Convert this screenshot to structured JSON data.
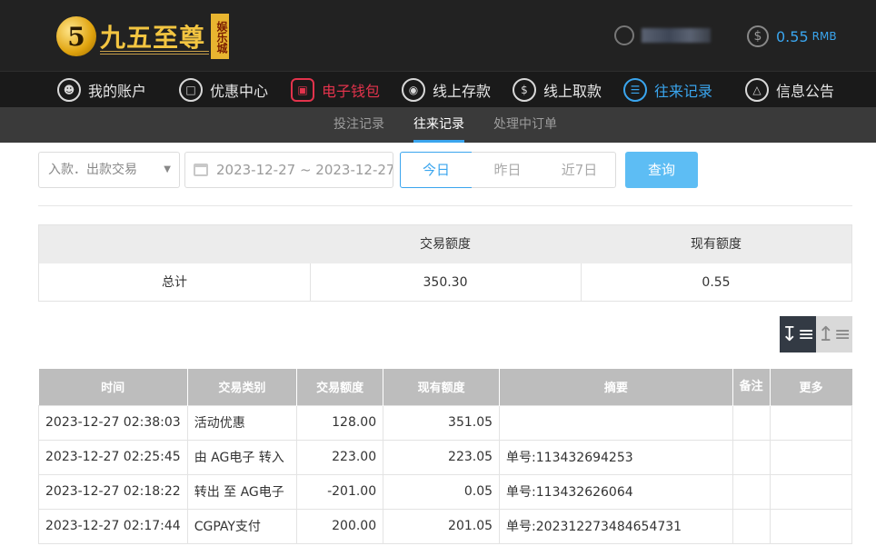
{
  "header": {
    "logo_numeral": "5",
    "logo_text": "九五至尊",
    "logo_badge": "娱乐城",
    "balance_symbol": "$",
    "balance_value": "0.55",
    "balance_unit": "RMB"
  },
  "nav": {
    "items": [
      {
        "label": "我的账户",
        "icon": "user-icon"
      },
      {
        "label": "优惠中心",
        "icon": "gift-icon"
      },
      {
        "label": "电子钱包",
        "icon": "wallet-icon"
      },
      {
        "label": "线上存款",
        "icon": "deposit-icon"
      },
      {
        "label": "线上取款",
        "icon": "withdraw-icon"
      },
      {
        "label": "往来记录",
        "icon": "records-icon"
      },
      {
        "label": "信息公告",
        "icon": "bell-icon"
      }
    ],
    "active_color": "#3aa5ee",
    "highlight_color": "#e2334c"
  },
  "subnav": {
    "items": [
      "投注记录",
      "往来记录",
      "处理中订单"
    ],
    "active": "往来记录"
  },
  "filters": {
    "type_select": "入款．出款交易",
    "date_range": "2023-12-27 ~ 2023-12-27",
    "segments": [
      "今日",
      "昨日",
      "近7日"
    ],
    "active_segment": "今日",
    "query_label": "查询"
  },
  "summary": {
    "headers": [
      "",
      "交易额度",
      "现有额度"
    ],
    "row_label": "总计",
    "trade_amount": "350.30",
    "current_amount": "0.55"
  },
  "table": {
    "headers": [
      "时间",
      "交易类别",
      "交易额度",
      "现有额度",
      "摘要",
      "备注",
      "更多"
    ],
    "rows": [
      {
        "time": "2023-12-27 02:38:03",
        "type": "活动优惠",
        "amount": "128.00",
        "balance": "351.05",
        "summary": "",
        "note": "",
        "more": ""
      },
      {
        "time": "2023-12-27 02:25:45",
        "type": "由 AG电子 转入",
        "amount": "223.00",
        "balance": "223.05",
        "summary": "单号:113432694253",
        "note": "",
        "more": ""
      },
      {
        "time": "2023-12-27 02:18:22",
        "type": "转出 至 AG电子",
        "amount": "-201.00",
        "balance": "0.05",
        "summary": "单号:113432626064",
        "note": "",
        "more": ""
      },
      {
        "time": "2023-12-27 02:17:44",
        "type": "CGPAY支付",
        "amount": "200.00",
        "balance": "201.05",
        "summary": "单号:202312273484654731",
        "note": "",
        "more": ""
      }
    ]
  }
}
